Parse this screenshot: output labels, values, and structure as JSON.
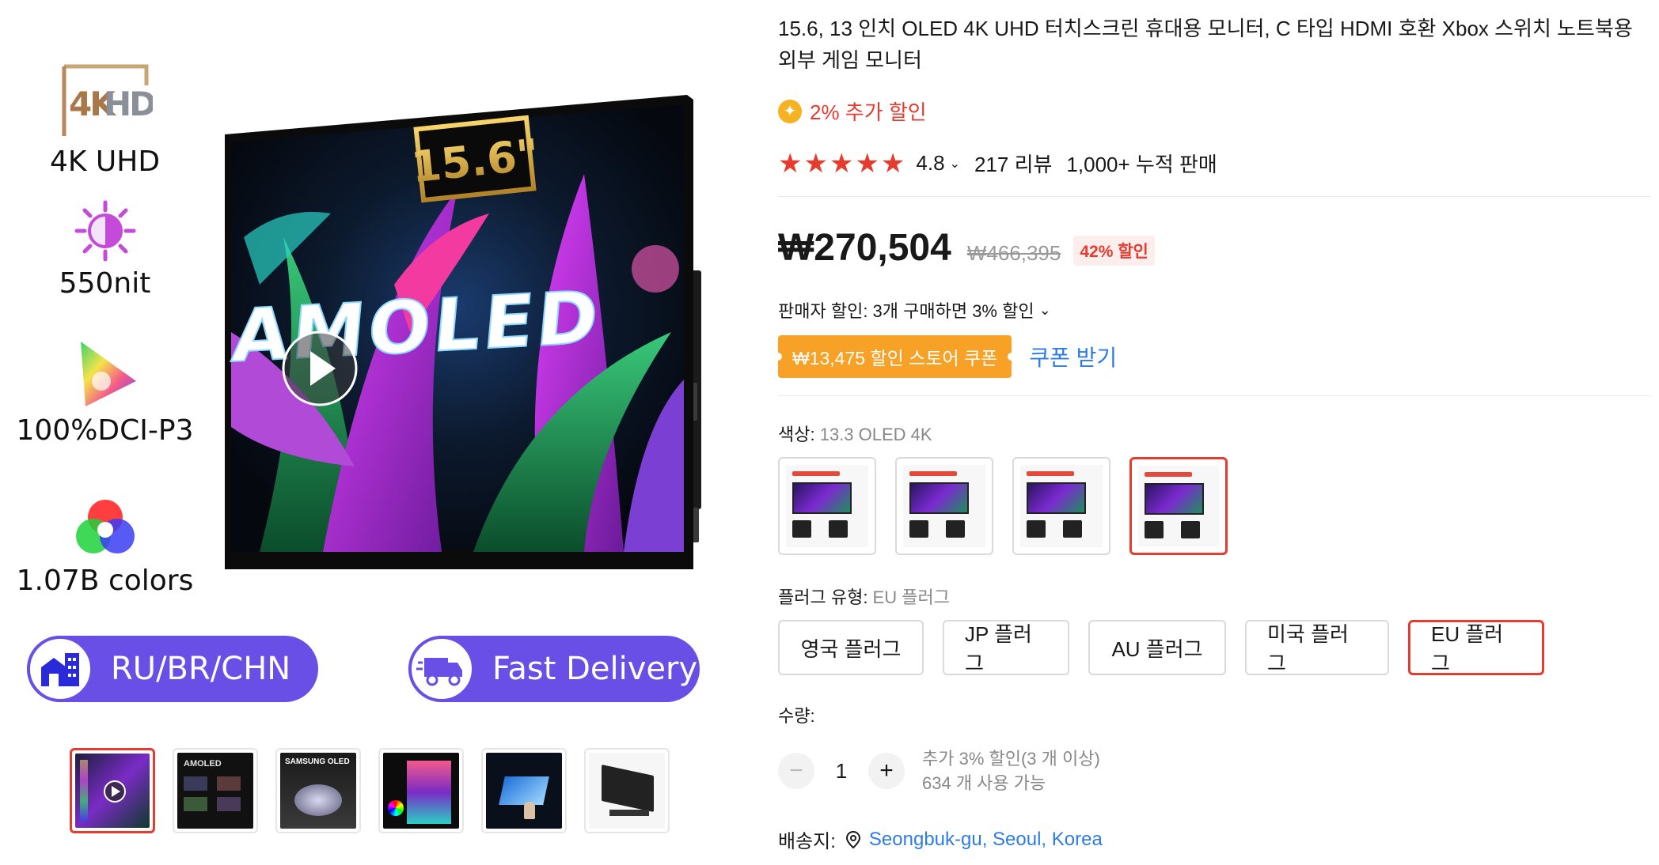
{
  "gallery": {
    "features": [
      {
        "icon": "4k-hdr-logo",
        "logo_text": "4KHDR",
        "label": "4K UHD"
      },
      {
        "icon": "brightness-icon",
        "label": "550nit"
      },
      {
        "icon": "color-gamut-icon",
        "label": "100%DCI-P3"
      },
      {
        "icon": "rgb-circles-icon",
        "label": "1.07B colors"
      }
    ],
    "main_image": {
      "size_badge": "15.6\"",
      "screen_text": "AMOLED"
    },
    "pills": [
      {
        "icon": "warehouse-icon",
        "label": "RU/BR/CHN"
      },
      {
        "icon": "delivery-truck-icon",
        "label": "Fast Delivery"
      }
    ],
    "thumbnails": [
      {
        "name": "thumb-video",
        "active": true
      },
      {
        "name": "thumb-amoled-features",
        "active": false
      },
      {
        "name": "thumb-samsung-oled",
        "active": false
      },
      {
        "name": "thumb-color",
        "active": false
      },
      {
        "name": "thumb-touch",
        "active": false
      },
      {
        "name": "thumb-stand",
        "active": false
      }
    ],
    "thumb_text": {
      "t3": "SAMSUNG OLED",
      "t2": "AMOLED"
    }
  },
  "product": {
    "title": "15.6, 13 인치 OLED 4K UHD 터치스크린 휴대용 모니터, C 타입 HDMI 호환 Xbox 스위치 노트북용 외부 게임 모니터",
    "extra_discount": "2% 추가 할인",
    "stars": "★★★★★",
    "rating": "4.8",
    "reviews": "217 리뷰",
    "sold": "1,000+ 누적 판매",
    "price": "₩270,504",
    "original_price": "₩466,395",
    "discount_badge": "42% 할인",
    "seller_discount": "판매자 할인: 3개 구매하면 3% 할인",
    "coupon": "₩13,475 할인 스토어 쿠폰",
    "coupon_link": "쿠폰 받기",
    "color_label": "색상: ",
    "color_value": "13.3 OLED 4K",
    "plug_label": "플러그 유형: ",
    "plug_value": "EU 플러그",
    "plugs": [
      "영국 플러그",
      "JP 플러그",
      "AU 플러그",
      "미국 플러그",
      "EU 플러그"
    ],
    "qty_label": "수량:",
    "qty": "1",
    "qty_note1": "추가 3% 할인(3 개 이상)",
    "qty_note2": "634 개 사용 가능",
    "ship_label": "배송지:",
    "ship_location": "Seongbuk-gu, Seoul, Korea",
    "accent_color": "#e63b2e",
    "coupon_color": "#f7a227",
    "link_color": "#2e7be6",
    "pill_color": "#6a4fe6"
  }
}
